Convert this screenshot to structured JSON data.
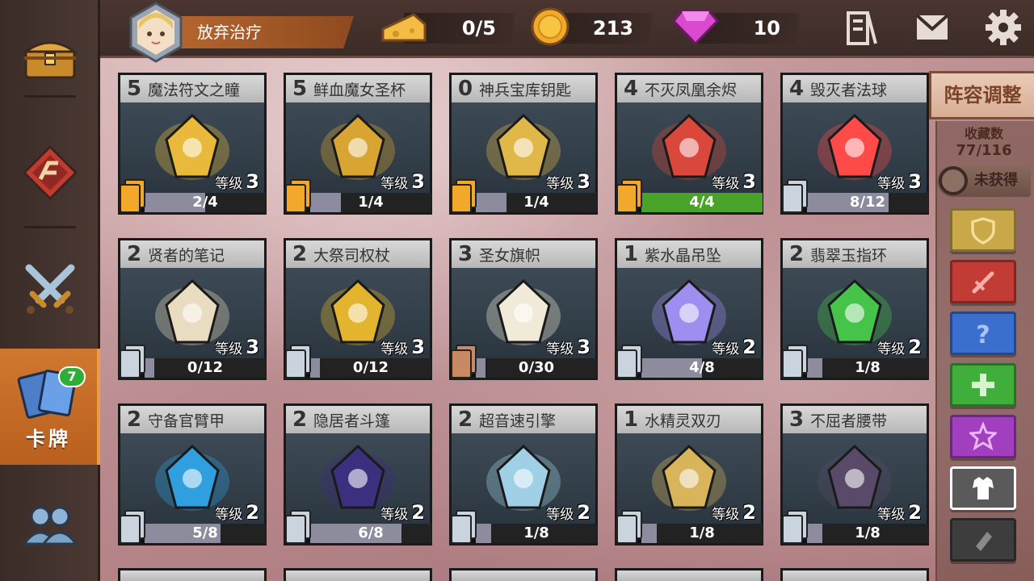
{
  "colors": {
    "gold": "#f2a82a",
    "silver": "#c9d4de",
    "bronze": "#c98a63",
    "full_bar": "#4aa329",
    "sidebar_active": "#c86a25"
  },
  "sidebar": {
    "items": [
      {
        "icon": "treasure-chest-icon"
      },
      {
        "icon": "rune-emblem-icon"
      },
      {
        "icon": "crossed-swords-icon"
      },
      {
        "icon": "cards-icon",
        "label": "卡牌",
        "badge": "7",
        "active": true
      },
      {
        "icon": "users-icon"
      }
    ]
  },
  "topbar": {
    "player_name": "放弃治疗",
    "cheese": "0/5",
    "coins": "213",
    "gems": "10",
    "icons": [
      "book-icon",
      "mail-icon",
      "gear-icon"
    ]
  },
  "right_panel": {
    "lineup_label": "阵容调整",
    "collection_label": "收藏数",
    "collection_count": "77/116",
    "unowned_label": "未获得",
    "filters": [
      {
        "icon": "shield-icon",
        "color": "#c9a84a"
      },
      {
        "icon": "sword-icon",
        "color": "#c23b35"
      },
      {
        "icon": "question-icon",
        "color": "#3a6fd0"
      },
      {
        "icon": "plus-icon",
        "color": "#3fae3a"
      },
      {
        "icon": "star-icon",
        "color": "#a13fbf"
      },
      {
        "icon": "armor-icon",
        "color": "#6a6a6a",
        "selected": true
      },
      {
        "icon": "scroll-icon",
        "color": "#3d3d3d"
      }
    ]
  },
  "level_label": "等级",
  "cards": [
    {
      "star": "5",
      "name": "魔法符文之瞳",
      "level": "3",
      "progress": "2/4",
      "ratio": 0.5,
      "rarity": "gold",
      "art": "#e8b93a"
    },
    {
      "star": "5",
      "name": "鲜血魔女圣杯",
      "level": "3",
      "progress": "1/4",
      "ratio": 0.25,
      "rarity": "gold",
      "art": "#d9a532"
    },
    {
      "star": "0",
      "name": "神兵宝库钥匙",
      "level": "3",
      "progress": "1/4",
      "ratio": 0.25,
      "rarity": "gold",
      "art": "#e0b84a"
    },
    {
      "star": "4",
      "name": "不灭凤凰余烬",
      "level": "3",
      "progress": "4/4",
      "ratio": 1.0,
      "rarity": "gold",
      "art": "#d9483a"
    },
    {
      "star": "4",
      "name": "毁灭者法球",
      "level": "3",
      "progress": "8/12",
      "ratio": 0.67,
      "rarity": "silver",
      "art": "#ff4a4a"
    },
    {
      "star": "2",
      "name": "贤者的笔记",
      "level": "3",
      "progress": "0/12",
      "ratio": 0,
      "rarity": "silver",
      "art": "#e9dcc0"
    },
    {
      "star": "2",
      "name": "大祭司权杖",
      "level": "3",
      "progress": "0/12",
      "ratio": 0,
      "rarity": "silver",
      "art": "#e3b52f"
    },
    {
      "star": "3",
      "name": "圣女旗帜",
      "level": "3",
      "progress": "0/30",
      "ratio": 0,
      "rarity": "bronze",
      "art": "#f1ead8"
    },
    {
      "star": "1",
      "name": "紫水晶吊坠",
      "level": "2",
      "progress": "4/8",
      "ratio": 0.5,
      "rarity": "silver",
      "art": "#9e8ef0"
    },
    {
      "star": "2",
      "name": "翡翠玉指环",
      "level": "2",
      "progress": "1/8",
      "ratio": 0.125,
      "rarity": "silver",
      "art": "#46c44a"
    },
    {
      "star": "2",
      "name": "守备官臂甲",
      "level": "2",
      "progress": "5/8",
      "ratio": 0.625,
      "rarity": "silver",
      "art": "#2f9fe0"
    },
    {
      "star": "2",
      "name": "隐居者斗篷",
      "level": "2",
      "progress": "6/8",
      "ratio": 0.75,
      "rarity": "silver",
      "art": "#3b2f80"
    },
    {
      "star": "2",
      "name": "超音速引擎",
      "level": "2",
      "progress": "1/8",
      "ratio": 0.125,
      "rarity": "silver",
      "art": "#9fd0e6"
    },
    {
      "star": "1",
      "name": "水精灵双刃",
      "level": "2",
      "progress": "1/8",
      "ratio": 0.125,
      "rarity": "silver",
      "art": "#d8b45a"
    },
    {
      "star": "3",
      "name": "不屈者腰带",
      "level": "2",
      "progress": "1/8",
      "ratio": 0.125,
      "rarity": "silver",
      "art": "#5a4a6a"
    }
  ]
}
